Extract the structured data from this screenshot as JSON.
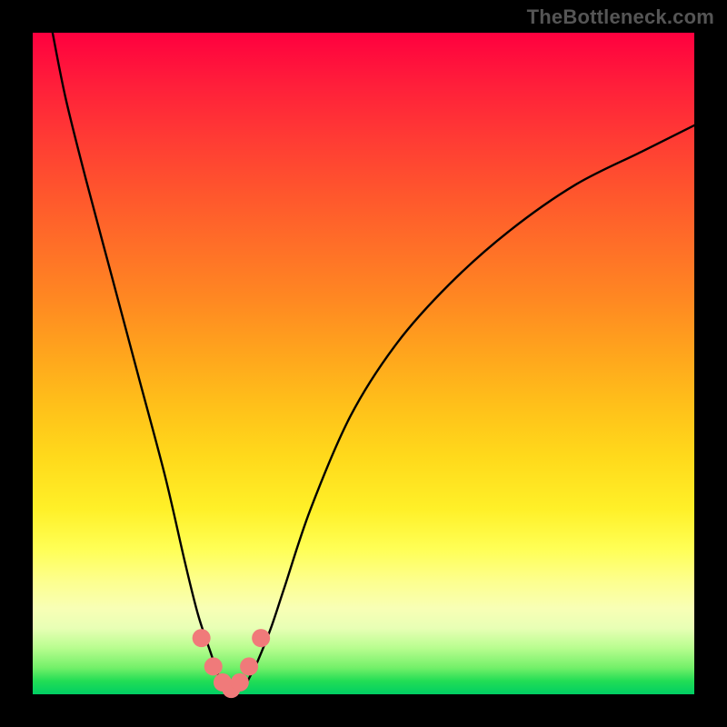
{
  "watermark": "TheBottleneck.com",
  "chart_data": {
    "type": "line",
    "title": "",
    "xlabel": "",
    "ylabel": "",
    "xlim": [
      0,
      100
    ],
    "ylim": [
      0,
      100
    ],
    "grid": false,
    "legend": false,
    "series": [
      {
        "name": "bottleneck-curve",
        "x": [
          3,
          5,
          8,
          12,
          16,
          20,
          23,
          25,
          27,
          28,
          29,
          30,
          31,
          32,
          33,
          34,
          36,
          38,
          42,
          48,
          55,
          63,
          72,
          82,
          92,
          100
        ],
        "values": [
          100,
          90,
          78,
          63,
          48,
          33,
          20,
          12,
          6,
          3,
          1.2,
          0.6,
          0.6,
          1.2,
          3,
          5,
          10,
          16,
          28,
          42,
          53,
          62,
          70,
          77,
          82,
          86
        ]
      }
    ],
    "markers": {
      "name": "highlight-points",
      "color": "#f07a7a",
      "radius": 10,
      "x": [
        25.5,
        27.3,
        28.7,
        30.0,
        31.3,
        32.7,
        34.5
      ],
      "values": [
        8.5,
        4.2,
        1.8,
        0.8,
        1.8,
        4.2,
        8.5
      ]
    }
  }
}
